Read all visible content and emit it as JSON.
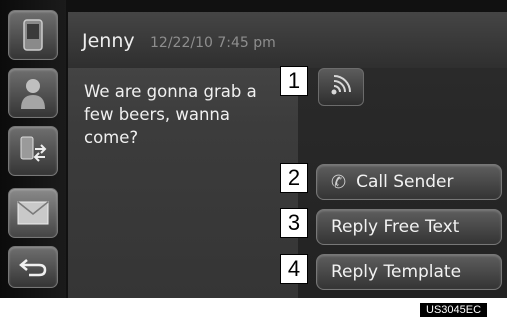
{
  "message": {
    "sender": "Jenny",
    "timestamp": "12/22/10 7:45 pm",
    "body": "We are gonna grab a few beers, wanna come?"
  },
  "sidebar": {
    "items": [
      {
        "icon": "phone-device-icon"
      },
      {
        "icon": "contact-person-icon"
      },
      {
        "icon": "transfer-icon"
      },
      {
        "icon": "envelope-icon",
        "active": true
      },
      {
        "icon": "back-arrow-icon"
      }
    ]
  },
  "callouts": [
    "1",
    "2",
    "3",
    "4"
  ],
  "actions": {
    "call_sender": "Call Sender",
    "reply_free_text": "Reply Free Text",
    "reply_template": "Reply Template"
  },
  "image_code": "US3045EC"
}
